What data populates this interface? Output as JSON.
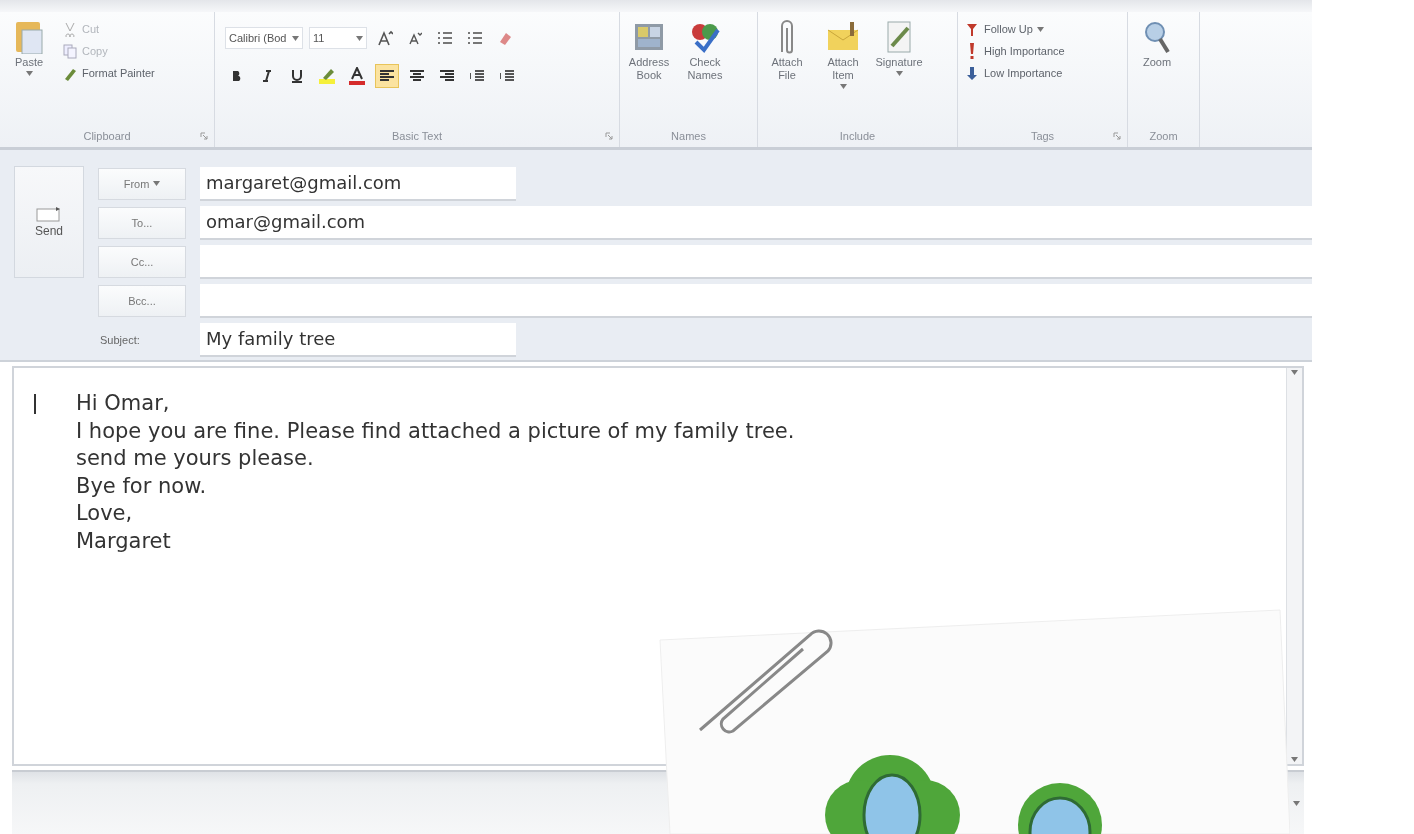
{
  "ribbon": {
    "groups": [
      {
        "label": "Clipboard",
        "kind": "clipboard",
        "launcher": true,
        "large": [
          {
            "label": "Paste",
            "dropdown": true
          }
        ],
        "small": [
          {
            "label": "Cut",
            "disabled": true
          },
          {
            "label": "Copy",
            "disabled": true
          },
          {
            "label": "Format Painter",
            "disabled": false
          }
        ]
      },
      {
        "label": "Basic Text",
        "kind": "text",
        "launcher": true,
        "font_name": "Calibri (Bod",
        "font_size": "11",
        "alignment": [
          {
            "selected": true
          },
          {
            "selected": false
          },
          {
            "selected": false
          }
        ]
      },
      {
        "label": "Names",
        "kind": "large",
        "launcher": false,
        "large": [
          {
            "label": "Address Book",
            "dropdown": false
          },
          {
            "label": "Check Names",
            "dropdown": false
          }
        ]
      },
      {
        "label": "Include",
        "kind": "large",
        "launcher": false,
        "large": [
          {
            "label": "Attach File",
            "dropdown": false
          },
          {
            "label": "Attach Item",
            "dropdown": true
          },
          {
            "label": "Signature",
            "dropdown": true
          }
        ]
      },
      {
        "label": "Tags",
        "kind": "tags",
        "launcher": true,
        "small": [
          {
            "label": "Follow Up",
            "dropdown": true
          },
          {
            "label": "High Importance",
            "dropdown": false
          },
          {
            "label": "Low Importance",
            "dropdown": false
          }
        ]
      },
      {
        "label": "Zoom",
        "kind": "large",
        "launcher": false,
        "large": [
          {
            "label": "Zoom",
            "dropdown": false
          }
        ]
      }
    ]
  },
  "send_button": {
    "label": "Send"
  },
  "fields": [
    {
      "kind": "button",
      "label": "From",
      "dropdown": true,
      "value": "margaret@gmail.com"
    },
    {
      "kind": "button",
      "label": "To...",
      "dropdown": false,
      "value": "omar@gmail.com"
    },
    {
      "kind": "button",
      "label": "Cc...",
      "dropdown": false
    },
    {
      "kind": "button",
      "label": "Bcc...",
      "dropdown": false
    },
    {
      "kind": "label",
      "label": "Subject:",
      "value": "My family tree"
    }
  ],
  "body": {
    "lines": [
      "Hi Omar,",
      "I hope you are fine. Please find attached a picture of my family tree.",
      "send me yours please.",
      "Bye for now.",
      "Love,",
      "Margaret"
    ]
  }
}
